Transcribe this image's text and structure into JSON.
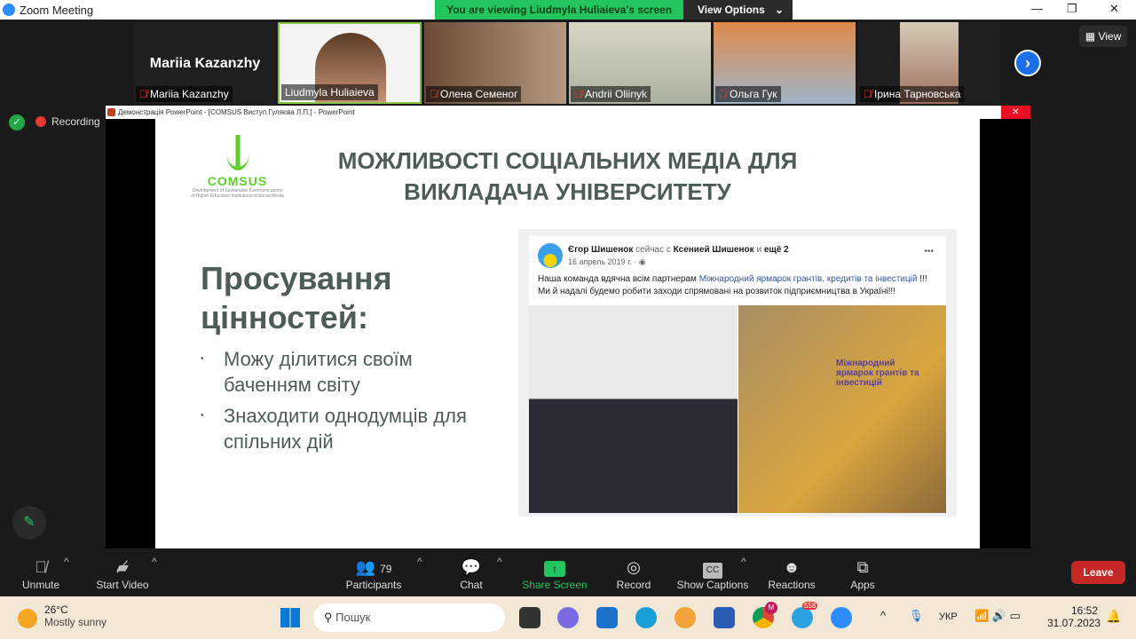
{
  "window": {
    "title": "Zoom Meeting",
    "banner": "You are viewing Liudmyla Huliaieva's screen",
    "view_options": "View Options",
    "view": "View"
  },
  "participants_strip": [
    {
      "name": "Mariia Kazanzhy",
      "big_name": "Mariia Kazanzhy",
      "muted": true
    },
    {
      "name": "Liudmyla Huliaieva",
      "muted": false
    },
    {
      "name": "Олена Семеног",
      "muted": true
    },
    {
      "name": "Andrii Oliinyk",
      "muted": true
    },
    {
      "name": "Ольга Гук",
      "muted": true
    },
    {
      "name": "Ірина Тарновська",
      "muted": true
    }
  ],
  "recording": "Recording",
  "ppt": {
    "window_title": "Демонстрація PowerPoint - [COMSUS  Виступ Гуляєва Л.П.] - PowerPoint"
  },
  "slide": {
    "logo": {
      "name": "COMSUS",
      "tagline": "Development of Sustainable Communications of Higher Education Institutions in Social Media"
    },
    "title_line1": "МОЖЛИВОСТІ СОЦІАЛЬНИХ МЕДІА ДЛЯ",
    "title_line2": "ВИКЛАДАЧА УНІВЕРСИТЕТУ",
    "heading_line1": "Просування",
    "heading_line2": "цінностей:",
    "bullets": [
      "Можу ділитися своїм баченням світу",
      "Знаходити  однодумців для спільних дій"
    ],
    "post": {
      "author": "Єгор Шишенок",
      "middle": " сейчас с ",
      "with": "Ксенией Шишенок",
      "and": " и ",
      "others": "ещё 2",
      "date": "16 апрель 2019 г. · ",
      "text_before": "Наша команда вдячна всім партнерам ",
      "link": "Міжнародний ярмарок грантів, кредитів та інвестицій",
      "text_after": " !!! Ми й надалі будемо робити заходи спрямовані на розвиток підприємництва в Україні!!!",
      "more": "•••",
      "sign_text": "Міжнародний ярмарок грантів та інвестицій"
    }
  },
  "toolbar": {
    "unmute": "Unmute",
    "start_video": "Start Video",
    "participants": "Participants",
    "participants_count": "79",
    "chat": "Chat",
    "share_screen": "Share Screen",
    "record": "Record",
    "captions": "Show Captions",
    "reactions": "Reactions",
    "apps": "Apps",
    "leave": "Leave"
  },
  "taskbar": {
    "temp": "26°C",
    "weather": "Mostly sunny",
    "search_placeholder": "Пошук",
    "telegram_badge": "558",
    "chrome_badge": "M",
    "lang": "УКР",
    "time": "16:52",
    "date": "31.07.2023"
  },
  "colors": {
    "share_green": "#22c55e",
    "leave_red": "#c62828",
    "slide_text": "#4d5d55",
    "logo_green": "#5ccf2a",
    "link_blue": "#385898"
  }
}
